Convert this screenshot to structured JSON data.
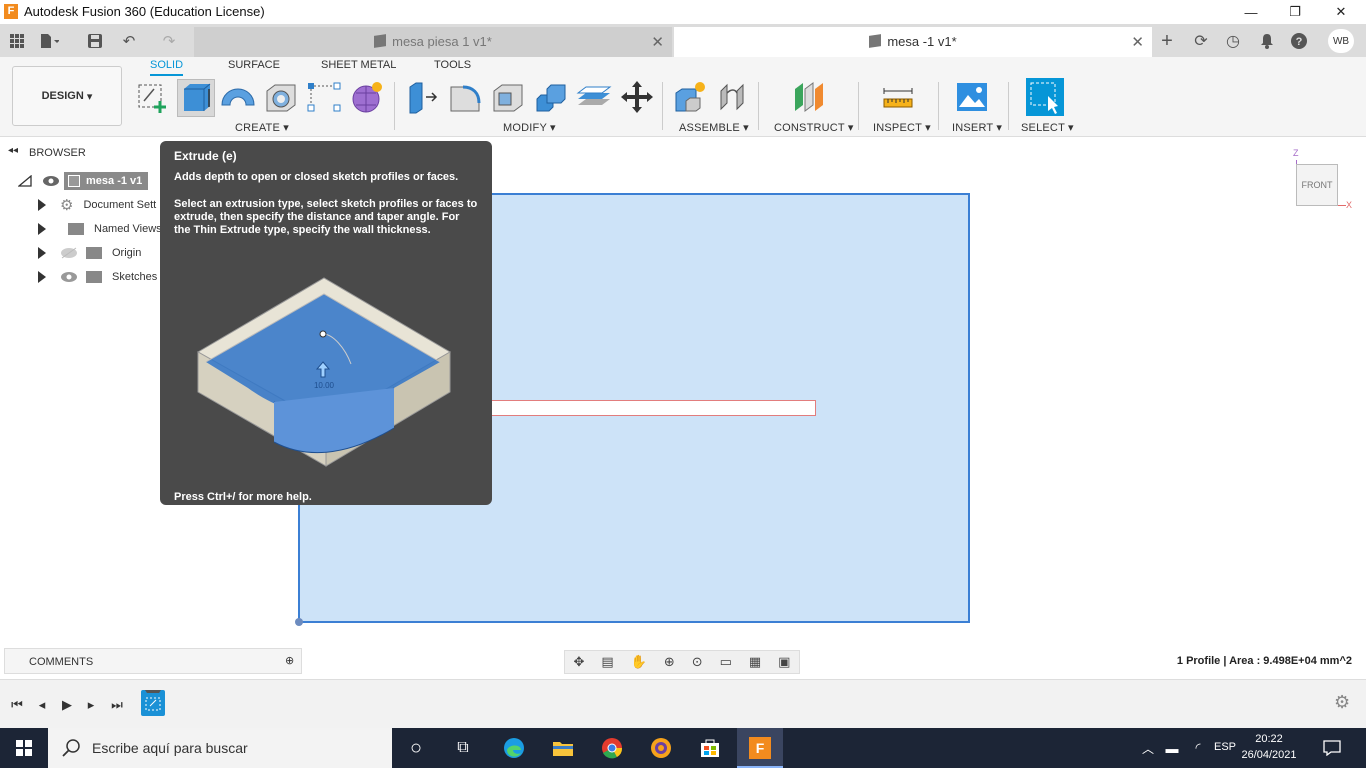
{
  "window": {
    "title": "Autodesk Fusion 360 (Education License)",
    "app_icon_letter": "F",
    "minimize": "—",
    "restore": "❐",
    "close": "✕"
  },
  "tabs": [
    {
      "name": "mesa piesa 1 v1*",
      "close": "✕",
      "active": false
    },
    {
      "name": "mesa -1 v1*",
      "close": "✕",
      "active": true
    }
  ],
  "user": {
    "initials": "WB"
  },
  "ribbon": {
    "workspace": "DESIGN",
    "tabs": [
      "SOLID",
      "SURFACE",
      "SHEET METAL",
      "TOOLS"
    ],
    "groups": {
      "create": "CREATE",
      "modify": "MODIFY",
      "assemble": "ASSEMBLE",
      "construct": "CONSTRUCT",
      "inspect": "INSPECT",
      "insert": "INSERT",
      "select": "SELECT"
    }
  },
  "browser": {
    "heading": "BROWSER",
    "root": "mesa -1 v1",
    "items": [
      "Document Sett",
      "Named Views",
      "Origin",
      "Sketches"
    ]
  },
  "tooltip": {
    "title": "Extrude (e)",
    "desc1": "Adds depth to open or closed sketch profiles or faces.",
    "desc2": "Select an extrusion type, select sketch profiles or faces to extrude, then specify the distance and taper angle. For the Thin Extrude type, specify the wall thickness.",
    "image_value": "10.00",
    "footer": "Press Ctrl+/ for more help."
  },
  "viewcube": {
    "face": "FRONT",
    "z": "Z",
    "x": "X"
  },
  "comments": {
    "label": "COMMENTS"
  },
  "status": {
    "text": "1 Profile | Area : 9.498E+04 mm^2"
  },
  "taskbar": {
    "search_placeholder": "Escribe aquí para buscar",
    "lang": "ESP",
    "time": "20:22",
    "date": "26/04/2021"
  },
  "colors": {
    "accent": "#0696d7",
    "sheet_fill": "#cde3f8",
    "sheet_border": "#3b7fd4",
    "tooltip_bg": "#4a4a4a",
    "taskbar_bg": "#1c2536"
  }
}
